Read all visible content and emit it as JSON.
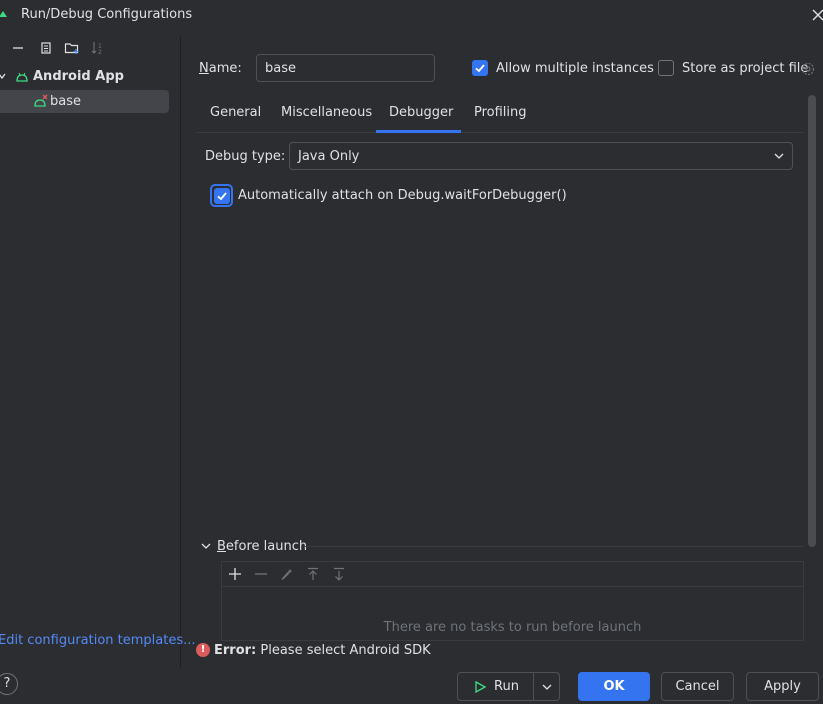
{
  "window": {
    "title": "Run/Debug Configurations"
  },
  "sidebar": {
    "group": {
      "label": "Android App"
    },
    "items": [
      {
        "label": "base"
      }
    ],
    "edit_templates_link": "Edit configuration templates..."
  },
  "config": {
    "name_label_mnemonic": "N",
    "name_label_rest": "ame:",
    "name_value": "base",
    "allow_multiple": {
      "label": "Allow multiple instances",
      "checked": true
    },
    "store_as_project": {
      "label": "Store as project file",
      "checked": false
    }
  },
  "tabs": [
    {
      "label": "General"
    },
    {
      "label": "Miscellaneous"
    },
    {
      "label": "Debugger",
      "active": true
    },
    {
      "label": "Profiling"
    }
  ],
  "debugger": {
    "debug_type_label": "Debug type:",
    "debug_type_value": "Java Only",
    "auto_attach": {
      "label": "Automatically attach on Debug.waitForDebugger()",
      "checked": true
    }
  },
  "before_launch": {
    "title_mnemonic": "B",
    "title_rest": "efore launch",
    "empty_text": "There are no tasks to run before launch"
  },
  "error": {
    "prefix": "Error:",
    "message": "Please select Android SDK"
  },
  "buttons": {
    "run": "Run",
    "ok": "OK",
    "cancel": "Cancel",
    "apply": "Apply",
    "help": "?"
  },
  "colors": {
    "accent": "#3574f0",
    "link": "#548af7",
    "error": "#db5c5c",
    "android": "#3ddc84"
  }
}
